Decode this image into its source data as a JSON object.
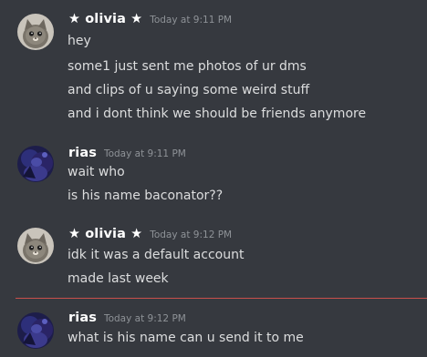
{
  "colors": {
    "background": "#36393f",
    "username": "#ffffff",
    "timestamp": "#8e9297",
    "message_text": "#dcddde",
    "new_messages_divider": "#c9504c"
  },
  "messages": [
    {
      "author": "★ olivia ★",
      "timestamp": "Today at 9:11 PM",
      "avatar": "cat-avatar",
      "lines": [
        "hey",
        "some1 just sent me photos of ur dms",
        "and clips of u saying some weird stuff",
        "and i dont think we should be friends anymore"
      ]
    },
    {
      "author": "rias",
      "timestamp": "Today at 9:11 PM",
      "avatar": "anime-avatar",
      "lines": [
        "wait who",
        "is his name baconator??"
      ]
    },
    {
      "author": "★ olivia ★",
      "timestamp": "Today at 9:12 PM",
      "avatar": "cat-avatar",
      "lines": [
        "idk it was a default account",
        "made last week"
      ]
    },
    {
      "author": "rias",
      "timestamp": "Today at 9:12 PM",
      "avatar": "anime-avatar",
      "lines": [
        "what is his name can u send it to me"
      ]
    }
  ]
}
